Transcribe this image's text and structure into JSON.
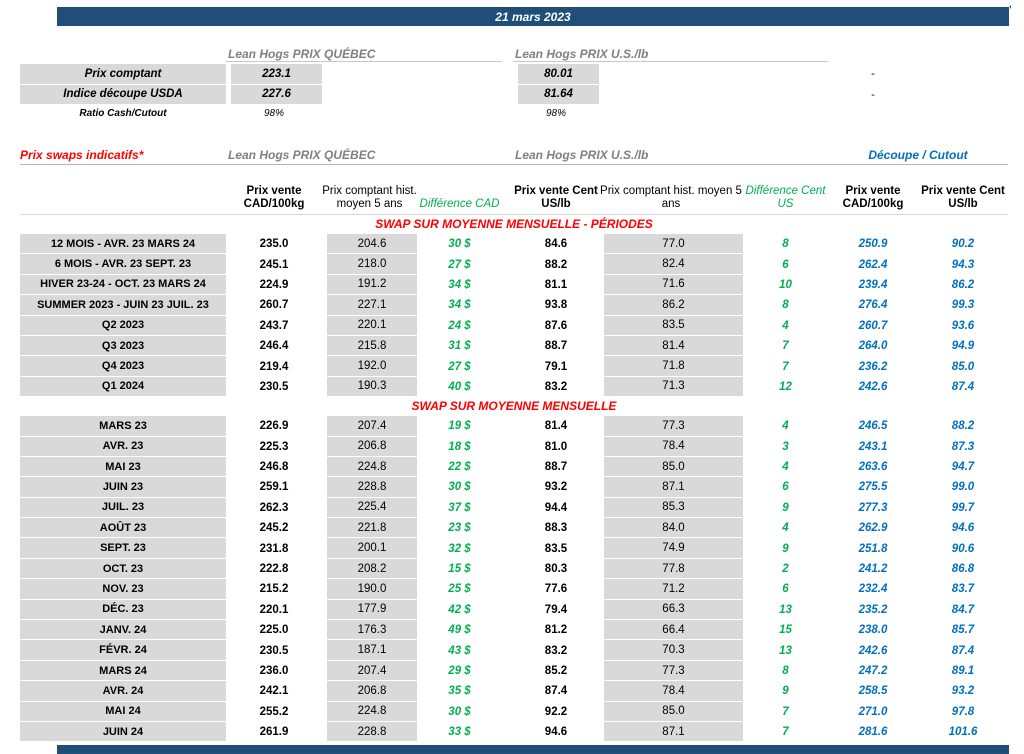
{
  "misc": {
    "corner_mark": ","
  },
  "title_bar": {
    "date": "21 mars 2023"
  },
  "spot": {
    "qc_header": "Lean Hogs PRIX QUÉBEC",
    "us_header": "Lean Hogs PRIX U.S./lb",
    "rows": [
      {
        "label": "Prix comptant",
        "qc": "223.1",
        "us": "80.01",
        "right": "-"
      },
      {
        "label": "Indice découpe USDA",
        "qc": "227.6",
        "us": "81.64",
        "right": "-"
      },
      {
        "label": "Ratio Cash/Cutout",
        "qc": "98%",
        "us": "98%",
        "right": ""
      }
    ]
  },
  "swaps": {
    "title": "Prix swaps indicatifs*",
    "qc_header": "Lean Hogs PRIX QUÉBEC",
    "us_header": "Lean Hogs PRIX U.S./lb",
    "cutout_header": "Découpe / Cutout",
    "col_headers": [
      "Prix vente CAD/100kg",
      "Prix comptant hist. moyen 5 ans",
      "Différence CAD",
      "Prix vente Cent US/lb",
      "Prix comptant hist. moyen 5 ans",
      "Différence Cent US",
      "Prix vente CAD/100kg",
      "Prix vente Cent US/lb"
    ],
    "periods_title": "SWAP SUR MOYENNE MENSUELLE - PÉRIODES",
    "monthly_title": "SWAP SUR MOYENNE MENSUELLE",
    "period_rows": [
      {
        "label": "12 MOIS - AVR. 23 MARS 24",
        "cells": [
          "235.0",
          "204.6",
          "30 $",
          "84.6",
          "77.0",
          "8",
          "250.9",
          "90.2"
        ]
      },
      {
        "label": "6 MOIS - AVR. 23 SEPT. 23",
        "cells": [
          "245.1",
          "218.0",
          "27 $",
          "88.2",
          "82.4",
          "6",
          "262.4",
          "94.3"
        ]
      },
      {
        "label": "HIVER 23-24 -  OCT. 23 MARS 24",
        "cells": [
          "224.9",
          "191.2",
          "34 $",
          "81.1",
          "71.6",
          "10",
          "239.4",
          "86.2"
        ]
      },
      {
        "label": "SUMMER 2023 - JUIN 23 JUIL. 23",
        "cells": [
          "260.7",
          "227.1",
          "34 $",
          "93.8",
          "86.2",
          "8",
          "276.4",
          "99.3"
        ]
      },
      {
        "label": "Q2 2023",
        "cells": [
          "243.7",
          "220.1",
          "24 $",
          "87.6",
          "83.5",
          "4",
          "260.7",
          "93.6"
        ]
      },
      {
        "label": "Q3 2023",
        "cells": [
          "246.4",
          "215.8",
          "31 $",
          "88.7",
          "81.4",
          "7",
          "264.0",
          "94.9"
        ]
      },
      {
        "label": "Q4 2023",
        "cells": [
          "219.4",
          "192.0",
          "27 $",
          "79.1",
          "71.8",
          "7",
          "236.2",
          "85.0"
        ]
      },
      {
        "label": "Q1 2024",
        "cells": [
          "230.5",
          "190.3",
          "40 $",
          "83.2",
          "71.3",
          "12",
          "242.6",
          "87.4"
        ]
      }
    ],
    "monthly_rows": [
      {
        "label": "MARS 23",
        "cells": [
          "226.9",
          "207.4",
          "19 $",
          "81.4",
          "77.3",
          "4",
          "246.5",
          "88.2"
        ]
      },
      {
        "label": "AVR. 23",
        "cells": [
          "225.3",
          "206.8",
          "18 $",
          "81.0",
          "78.4",
          "3",
          "243.1",
          "87.3"
        ]
      },
      {
        "label": "MAI 23",
        "cells": [
          "246.8",
          "224.8",
          "22 $",
          "88.7",
          "85.0",
          "4",
          "263.6",
          "94.7"
        ]
      },
      {
        "label": "JUIN 23",
        "cells": [
          "259.1",
          "228.8",
          "30 $",
          "93.2",
          "87.1",
          "6",
          "275.5",
          "99.0"
        ]
      },
      {
        "label": "JUIL. 23",
        "cells": [
          "262.3",
          "225.4",
          "37 $",
          "94.4",
          "85.3",
          "9",
          "277.3",
          "99.7"
        ]
      },
      {
        "label": "AOÛT 23",
        "cells": [
          "245.2",
          "221.8",
          "23 $",
          "88.3",
          "84.0",
          "4",
          "262.9",
          "94.6"
        ]
      },
      {
        "label": "SEPT. 23",
        "cells": [
          "231.8",
          "200.1",
          "32 $",
          "83.5",
          "74.9",
          "9",
          "251.8",
          "90.6"
        ]
      },
      {
        "label": "OCT. 23",
        "cells": [
          "222.8",
          "208.2",
          "15 $",
          "80.3",
          "77.8",
          "2",
          "241.2",
          "86.8"
        ]
      },
      {
        "label": "NOV. 23",
        "cells": [
          "215.2",
          "190.0",
          "25 $",
          "77.6",
          "71.2",
          "6",
          "232.4",
          "83.7"
        ]
      },
      {
        "label": "DÉC. 23",
        "cells": [
          "220.1",
          "177.9",
          "42 $",
          "79.4",
          "66.3",
          "13",
          "235.2",
          "84.7"
        ]
      },
      {
        "label": "JANV. 24",
        "cells": [
          "225.0",
          "176.3",
          "49 $",
          "81.2",
          "66.4",
          "15",
          "238.0",
          "85.7"
        ]
      },
      {
        "label": "FÉVR. 24",
        "cells": [
          "230.5",
          "187.1",
          "43 $",
          "83.2",
          "70.3",
          "13",
          "242.6",
          "87.4"
        ]
      },
      {
        "label": "MARS 24",
        "cells": [
          "236.0",
          "207.4",
          "29 $",
          "85.2",
          "77.3",
          "8",
          "247.2",
          "89.1"
        ]
      },
      {
        "label": "AVR. 24",
        "cells": [
          "242.1",
          "206.8",
          "35 $",
          "87.4",
          "78.4",
          "9",
          "258.5",
          "93.2"
        ]
      },
      {
        "label": "MAI 24",
        "cells": [
          "255.2",
          "224.8",
          "30 $",
          "92.2",
          "85.0",
          "7",
          "271.0",
          "97.8"
        ]
      },
      {
        "label": "JUIN 24",
        "cells": [
          "261.9",
          "228.8",
          "33 $",
          "94.6",
          "87.1",
          "7",
          "281.6",
          "101.6"
        ]
      }
    ]
  }
}
